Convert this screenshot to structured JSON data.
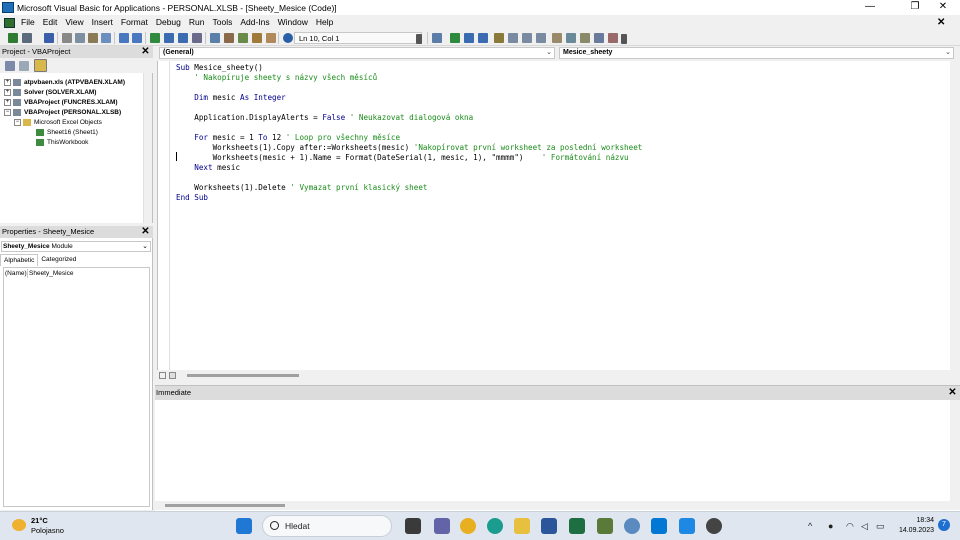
{
  "window": {
    "title": "Microsoft Visual Basic for Applications - PERSONAL.XLSB - [Sheety_Mesice (Code)]",
    "minimize": "—",
    "restore": "❐",
    "close": "✕"
  },
  "menubar": {
    "items": [
      "File",
      "Edit",
      "View",
      "Insert",
      "Format",
      "Debug",
      "Run",
      "Tools",
      "Add-Ins",
      "Window",
      "Help"
    ],
    "close_child": "✕"
  },
  "toolbar": {
    "position_label": "Ln 10, Col 1"
  },
  "project_pane": {
    "title": "Project - VBAProject",
    "close": "✕",
    "tree": [
      {
        "label": "atpvbaen.xls (ATPVBAEN.XLAM)",
        "bold": true,
        "level": 0
      },
      {
        "label": "Solver (SOLVER.XLAM)",
        "bold": true,
        "level": 0
      },
      {
        "label": "VBAProject (FUNCRES.XLAM)",
        "bold": true,
        "level": 0
      },
      {
        "label": "VBAProject (PERSONAL.XLSB)",
        "bold": true,
        "level": 0
      },
      {
        "label": "Microsoft Excel Objects",
        "bold": false,
        "level": 1
      },
      {
        "label": "Sheet16 (Sheet1)",
        "bold": false,
        "level": 2
      },
      {
        "label": "ThisWorkbook",
        "bold": false,
        "level": 2
      }
    ]
  },
  "properties_pane": {
    "title": "Properties - Sheety_Mesice",
    "close": "✕",
    "object_name": "Sheety_Mesice",
    "object_type": "Module",
    "tabs": [
      "Alphabetic",
      "Categorized"
    ],
    "rows": [
      {
        "key": "(Name)",
        "value": "Sheety_Mesice"
      }
    ]
  },
  "code_window": {
    "object_dropdown": "(General)",
    "procedure_dropdown": "Mesice_sheety",
    "lines": [
      [
        {
          "t": "kw",
          "s": "Sub "
        },
        {
          "t": "tx",
          "s": "Mesice_sheety()"
        }
      ],
      [
        {
          "t": "cm",
          "s": "    ' Nakopíruje sheety s názvy všech měsíců"
        }
      ],
      [
        {
          "t": "tx",
          "s": ""
        }
      ],
      [
        {
          "t": "kw",
          "s": "    Dim "
        },
        {
          "t": "tx",
          "s": "mesic "
        },
        {
          "t": "kw",
          "s": "As Integer"
        }
      ],
      [
        {
          "t": "tx",
          "s": ""
        }
      ],
      [
        {
          "t": "tx",
          "s": "    Application.DisplayAlerts = "
        },
        {
          "t": "kw",
          "s": "False"
        },
        {
          "t": "cm",
          "s": " ' Neukazovat dialogová okna"
        }
      ],
      [
        {
          "t": "tx",
          "s": ""
        }
      ],
      [
        {
          "t": "kw",
          "s": "    For "
        },
        {
          "t": "tx",
          "s": "mesic = 1 "
        },
        {
          "t": "kw",
          "s": "To "
        },
        {
          "t": "tx",
          "s": "12"
        },
        {
          "t": "cm",
          "s": " ' Loop pro všechny měsíce"
        }
      ],
      [
        {
          "t": "tx",
          "s": "        Worksheets(1).Copy after:=Worksheets(mesic)"
        },
        {
          "t": "cm",
          "s": " 'Nakopírovat první worksheet za poslední worksheet"
        }
      ],
      [
        {
          "t": "tx",
          "s": "        Worksheets(mesic + 1).Name = Format(DateSerial(1, mesic, 1), \"mmmm\")"
        },
        {
          "t": "cm",
          "s": "    ' Formátování názvu"
        }
      ],
      [
        {
          "t": "kw",
          "s": "    Next "
        },
        {
          "t": "tx",
          "s": "mesic"
        }
      ],
      [
        {
          "t": "tx",
          "s": ""
        }
      ],
      [
        {
          "t": "tx",
          "s": "    Worksheets(1).Delete"
        },
        {
          "t": "cm",
          "s": " ' Vymazat první klasický sheet"
        }
      ],
      [
        {
          "t": "kw",
          "s": "End Sub"
        }
      ]
    ]
  },
  "immediate_pane": {
    "title": "Immediate",
    "close": "✕"
  },
  "taskbar": {
    "weather_temp": "21°C",
    "weather_desc": "Polojasno",
    "search_placeholder": "Hledat",
    "time": "18:34",
    "date": "14.09.2023",
    "notification_count": "7"
  },
  "colors": {
    "keyword": "#00008b",
    "comment": "#1a8c1a",
    "pane_title_bg": "#dcdcdc"
  }
}
